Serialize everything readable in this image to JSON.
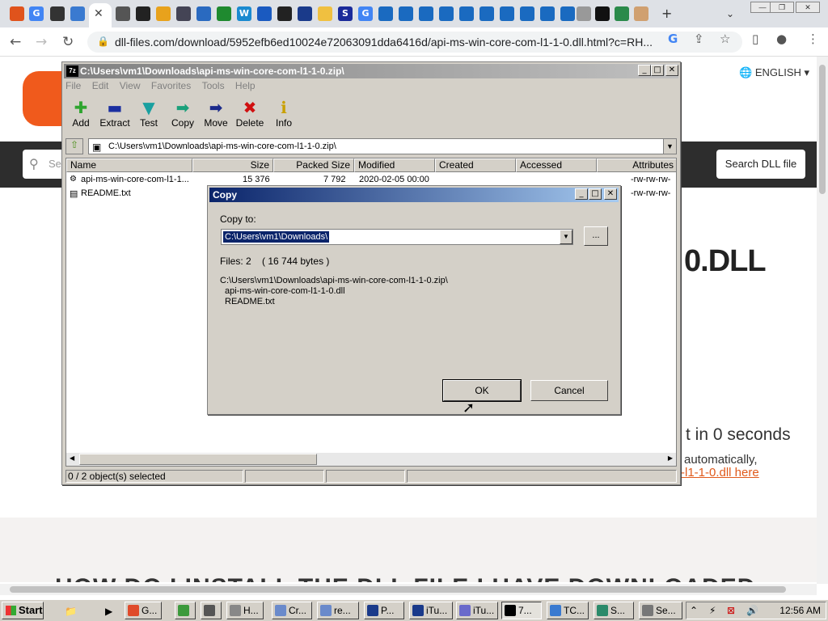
{
  "browser": {
    "url": "dll-files.com/download/5952efb6ed10024e72063091dda6416d/api-ms-win-core-com-l1-1-0.dll.html?c=RH..."
  },
  "page": {
    "language": "ENGLISH",
    "search_placeholder": "Se",
    "search_button": "Search DLL file",
    "heading_fragment": "0.DLL",
    "countdown": "t in 0 seconds",
    "auto_text": "automatically,",
    "download_link": "-l1-1-0.dll here",
    "big_heading": "HOW DO I INSTALL THE DLL FILE I HAVE DOWNLOADED"
  },
  "zip": {
    "title": "C:\\Users\\vm1\\Downloads\\api-ms-win-core-com-l1-1-0.zip\\",
    "app_icon": "7z",
    "menu": [
      "File",
      "Edit",
      "View",
      "Favorites",
      "Tools",
      "Help"
    ],
    "tools": [
      {
        "label": "Add",
        "icon": "add-icon",
        "color": "#2fa52f"
      },
      {
        "label": "Extract",
        "icon": "extract-icon",
        "color": "#1b2fa0"
      },
      {
        "label": "Test",
        "icon": "test-icon",
        "color": "#1aa0a0"
      },
      {
        "label": "Copy",
        "icon": "copy-icon",
        "color": "#1aa07a"
      },
      {
        "label": "Move",
        "icon": "move-icon",
        "color": "#1b2a8a"
      },
      {
        "label": "Delete",
        "icon": "delete-icon",
        "color": "#d01010"
      },
      {
        "label": "Info",
        "icon": "info-icon",
        "color": "#c9a000"
      }
    ],
    "path": "C:\\Users\\vm1\\Downloads\\api-ms-win-core-com-l1-1-0.zip\\",
    "columns": [
      "Name",
      "Size",
      "Packed Size",
      "Modified",
      "Created",
      "Accessed",
      "Attributes"
    ],
    "rows": [
      {
        "name": "api-ms-win-core-com-l1-1...",
        "size": "15 376",
        "packed": "7 792",
        "modified": "2020-02-05 00:00",
        "attributes": "-rw-rw-rw-"
      },
      {
        "name": "README.txt",
        "size": "",
        "packed": "",
        "modified": "",
        "attributes": "-rw-rw-rw-"
      }
    ],
    "status": "0 / 2 object(s) selected"
  },
  "copy_dialog": {
    "title": "Copy",
    "copy_to_label": "Copy to:",
    "destination": "C:\\Users\\vm1\\Downloads\\",
    "browse": "...",
    "files_info": "Files: 2    ( 16 744 bytes )",
    "source_path": "C:\\Users\\vm1\\Downloads\\api-ms-win-core-com-l1-1-0.zip\\",
    "source_files": [
      "api-ms-win-core-com-l1-1-0.dll",
      "README.txt"
    ],
    "ok": "OK",
    "cancel": "Cancel"
  },
  "taskbar": {
    "start": "Start",
    "tasks": [
      {
        "label": "G...",
        "color": "#e04a2a"
      },
      {
        "label": "",
        "color": "#3c9a3c"
      },
      {
        "label": "",
        "color": "#555"
      },
      {
        "label": "H...",
        "color": "#888"
      },
      {
        "label": "Cr...",
        "color": "#6a8acb"
      },
      {
        "label": "re...",
        "color": "#6a8acb"
      },
      {
        "label": "P...",
        "color": "#1a3a8a"
      },
      {
        "label": "iTu...",
        "color": "#1a3a8a"
      },
      {
        "label": "iTu...",
        "color": "#6a6acb"
      },
      {
        "label": "7...",
        "color": "#000"
      },
      {
        "label": "TC...",
        "color": "#3a7ad0"
      },
      {
        "label": "S...",
        "color": "#2a8a6a"
      },
      {
        "label": "Se...",
        "color": "#777"
      }
    ],
    "clock": "12:56 AM"
  }
}
